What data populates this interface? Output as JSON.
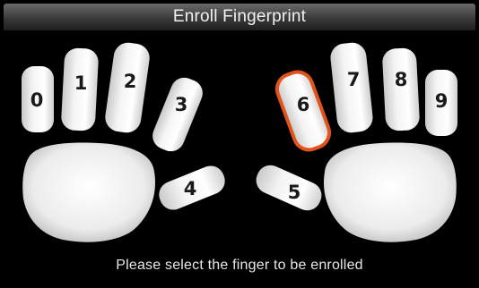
{
  "window": {
    "title": "Enroll Fingerprint"
  },
  "status": {
    "message": "Please select the finger to be enrolled"
  },
  "colors": {
    "selected_outline": "#e0541c",
    "finger_fill": "#f2f2f2",
    "background": "#000000"
  },
  "selected_finger": "6",
  "fingers": [
    {
      "label": "0",
      "hand": "left",
      "name": "left-little"
    },
    {
      "label": "1",
      "hand": "left",
      "name": "left-ring"
    },
    {
      "label": "2",
      "hand": "left",
      "name": "left-middle"
    },
    {
      "label": "3",
      "hand": "left",
      "name": "left-index"
    },
    {
      "label": "4",
      "hand": "left",
      "name": "left-thumb"
    },
    {
      "label": "5",
      "hand": "right",
      "name": "right-thumb"
    },
    {
      "label": "6",
      "hand": "right",
      "name": "right-index"
    },
    {
      "label": "7",
      "hand": "right",
      "name": "right-middle"
    },
    {
      "label": "8",
      "hand": "right",
      "name": "right-ring"
    },
    {
      "label": "9",
      "hand": "right",
      "name": "right-little"
    }
  ]
}
